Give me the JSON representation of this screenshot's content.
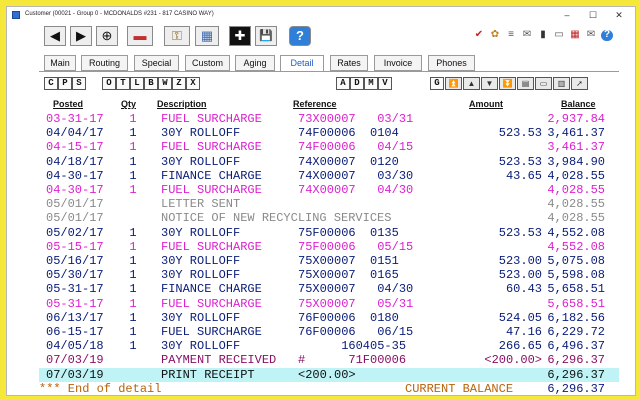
{
  "window": {
    "title": "Customer (00021 - Group 0 - MCDONALDS #231 - 817 CASINO WAY)",
    "controls": [
      "–",
      "☐",
      "✕"
    ]
  },
  "toolbar": {
    "buttons": [
      {
        "name": "back-arrow",
        "glyph": "◀"
      },
      {
        "name": "forward-arrow",
        "glyph": "▶"
      },
      {
        "name": "target-crosshair",
        "glyph": "⊕"
      },
      {
        "name": "eraser",
        "glyph": "▬"
      },
      {
        "name": "key",
        "glyph": "⚿"
      },
      {
        "name": "calculator",
        "glyph": "▦"
      },
      {
        "name": "add",
        "glyph": "✚"
      },
      {
        "name": "save",
        "glyph": "💾"
      },
      {
        "name": "help",
        "glyph": "?"
      }
    ],
    "right_icons": [
      {
        "name": "checkmark",
        "glyph": "✔"
      },
      {
        "name": "palette",
        "glyph": "✿"
      },
      {
        "name": "list",
        "glyph": "≡"
      },
      {
        "name": "message",
        "glyph": "✉"
      },
      {
        "name": "trash",
        "glyph": "▮"
      },
      {
        "name": "folder",
        "glyph": "▭"
      },
      {
        "name": "calendar",
        "glyph": "▦"
      },
      {
        "name": "email",
        "glyph": "✉"
      },
      {
        "name": "help",
        "glyph": "?"
      }
    ]
  },
  "tabs": [
    "Main",
    "Routing",
    "Special",
    "Custom",
    "Aging",
    "Detail",
    "Rates",
    "Invoice",
    "Phones"
  ],
  "active_tab": "Detail",
  "filters": {
    "left": [
      "C",
      "P",
      "S",
      "O",
      "T",
      "L",
      "B",
      "W",
      "Z",
      "X"
    ],
    "right": [
      "A",
      "D",
      "M",
      "V",
      "G"
    ],
    "icons": [
      {
        "name": "first-icon",
        "glyph": "⏫"
      },
      {
        "name": "up-icon",
        "glyph": "▲"
      },
      {
        "name": "down-icon",
        "glyph": "▼"
      },
      {
        "name": "last-icon",
        "glyph": "⏬"
      },
      {
        "name": "print-icon",
        "glyph": "▤"
      },
      {
        "name": "notes-icon",
        "glyph": "▭"
      },
      {
        "name": "export-icon",
        "glyph": "▥"
      },
      {
        "name": "send-icon",
        "glyph": "➚"
      }
    ]
  },
  "ledger": {
    "headers": {
      "posted": "Posted",
      "qty": "Qty",
      "description": "Description",
      "reference": "Reference",
      "amount": "Amount",
      "balance": "Balance"
    },
    "colors": {
      "magenta": "#dd1fd1",
      "navy": "#0a1c78",
      "gray": "#8a8a8a",
      "purple": "#8a1066",
      "orange": "#b8620a",
      "black": "#111111",
      "highlight": "#bff3f5"
    },
    "rows": [
      {
        "date": "03-31-17",
        "qty": "1",
        "desc": "FUEL SURCHARGE",
        "ref": "73X00007   03/31",
        "amt": "",
        "bal": "2,937.84",
        "color": "magenta"
      },
      {
        "date": "04/04/17",
        "qty": "1",
        "desc": "30Y ROLLOFF",
        "ref": "74F00006  0104",
        "amt": "523.53",
        "bal": "3,461.37",
        "color": "navy"
      },
      {
        "date": "04-15-17",
        "qty": "1",
        "desc": "FUEL SURCHARGE",
        "ref": "74F00006   04/15",
        "amt": "",
        "bal": "3,461.37",
        "color": "magenta"
      },
      {
        "date": "04/18/17",
        "qty": "1",
        "desc": "30Y ROLLOFF",
        "ref": "74X00007  0120",
        "amt": "523.53",
        "bal": "3,984.90",
        "color": "navy"
      },
      {
        "date": "04-30-17",
        "qty": "1",
        "desc": "FINANCE CHARGE",
        "ref": "74X00007   03/30",
        "amt": "43.65",
        "bal": "4,028.55",
        "color": "navy"
      },
      {
        "date": "04-30-17",
        "qty": "1",
        "desc": "FUEL SURCHARGE",
        "ref": "74X00007   04/30",
        "amt": "",
        "bal": "4,028.55",
        "color": "magenta"
      },
      {
        "date": "05/01/17",
        "qty": "",
        "desc": "LETTER SENT",
        "ref": "",
        "amt": "",
        "bal": "4,028.55",
        "color": "gray"
      },
      {
        "date": "05/01/17",
        "qty": "",
        "desc": "NOTICE OF NEW RECYCLING SERVICES",
        "ref": "",
        "amt": "",
        "bal": "4,028.55",
        "color": "gray"
      },
      {
        "date": "05/02/17",
        "qty": "1",
        "desc": "30Y ROLLOFF",
        "ref": "75F00006  0135",
        "amt": "523.53",
        "bal": "4,552.08",
        "color": "navy"
      },
      {
        "date": "05-15-17",
        "qty": "1",
        "desc": "FUEL SURCHARGE",
        "ref": "75F00006   05/15",
        "amt": "",
        "bal": "4,552.08",
        "color": "magenta"
      },
      {
        "date": "05/16/17",
        "qty": "1",
        "desc": "30Y ROLLOFF",
        "ref": "75X00007  0151",
        "amt": "523.00",
        "bal": "5,075.08",
        "color": "navy"
      },
      {
        "date": "05/30/17",
        "qty": "1",
        "desc": "30Y ROLLOFF",
        "ref": "75X00007  0165",
        "amt": "523.00",
        "bal": "5,598.08",
        "color": "navy"
      },
      {
        "date": "05-31-17",
        "qty": "1",
        "desc": "FINANCE CHARGE",
        "ref": "75X00007   04/30",
        "amt": "60.43",
        "bal": "5,658.51",
        "color": "navy"
      },
      {
        "date": "05-31-17",
        "qty": "1",
        "desc": "FUEL SURCHARGE",
        "ref": "75X00007   05/31",
        "amt": "",
        "bal": "5,658.51",
        "color": "magenta"
      },
      {
        "date": "06/13/17",
        "qty": "1",
        "desc": "30Y ROLLOFF",
        "ref": "76F00006  0180",
        "amt": "524.05",
        "bal": "6,182.56",
        "color": "navy"
      },
      {
        "date": "06-15-17",
        "qty": "1",
        "desc": "FUEL SURCHARGE",
        "ref": "76F00006   06/15",
        "amt": "47.16",
        "bal": "6,229.72",
        "color": "navy"
      },
      {
        "date": "04/05/18",
        "qty": "1",
        "desc": "30Y ROLLOFF",
        "ref": "      160405-35",
        "amt": "266.65",
        "bal": "6,496.37",
        "color": "navy"
      },
      {
        "date": "07/03/19",
        "qty": "",
        "desc": "PAYMENT RECEIVED",
        "ref": "#      71F00006",
        "amt": "<200.00>",
        "bal": "6,296.37",
        "color": "purple"
      },
      {
        "date": "07/03/19",
        "qty": "",
        "desc": "PRINT RECEIPT",
        "ref": "<200.00>",
        "amt": "",
        "bal": "6,296.37",
        "color": "black",
        "highlight": true
      }
    ],
    "footer": {
      "label": "*** End of detail",
      "current_label": "CURRENT BALANCE",
      "current_value": "6,296.37"
    }
  }
}
